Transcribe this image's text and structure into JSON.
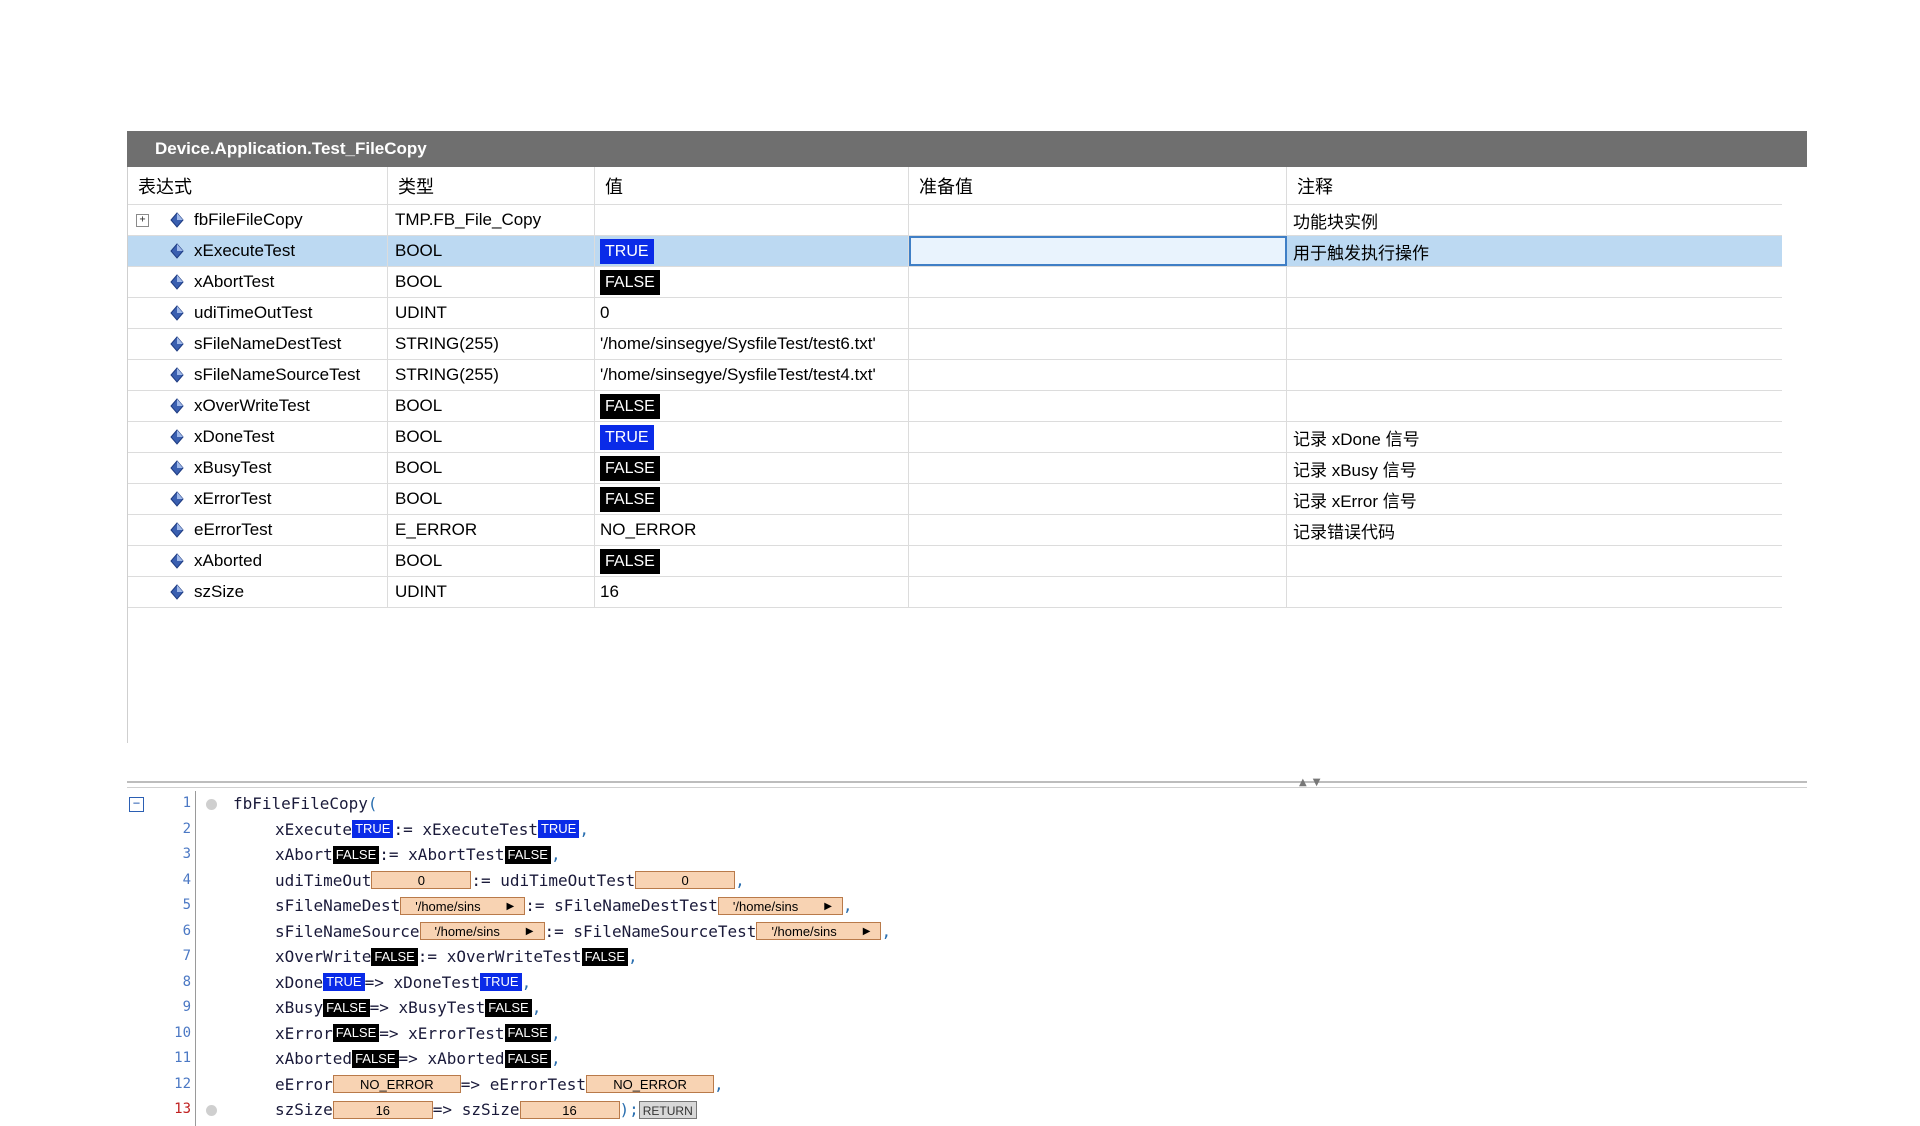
{
  "window": {
    "title": "Device.Application.Test_FileCopy"
  },
  "watch": {
    "headers": {
      "expression": "表达式",
      "type": "类型",
      "value": "值",
      "prepared": "准备值",
      "comment": "注释"
    },
    "rows": [
      {
        "name": "fbFileFileCopy",
        "type": "TMP.FB_File_Copy",
        "value": "",
        "comment": "功能块实例",
        "expand": "+"
      },
      {
        "name": "xExecuteTest",
        "type": "BOOL",
        "value": "TRUE",
        "comment": "用于触发执行操作"
      },
      {
        "name": "xAbortTest",
        "type": "BOOL",
        "value": "FALSE",
        "comment": ""
      },
      {
        "name": "udiTimeOutTest",
        "type": "UDINT",
        "value": "0",
        "comment": ""
      },
      {
        "name": "sFileNameDestTest",
        "type": "STRING(255)",
        "value": "'/home/sinsegye/SysfileTest/test6.txt'",
        "comment": ""
      },
      {
        "name": "sFileNameSourceTest",
        "type": "STRING(255)",
        "value": "'/home/sinsegye/SysfileTest/test4.txt'",
        "comment": ""
      },
      {
        "name": "xOverWriteTest",
        "type": "BOOL",
        "value": "FALSE",
        "comment": ""
      },
      {
        "name": "xDoneTest",
        "type": "BOOL",
        "value": "TRUE",
        "comment": "记录 xDone 信号"
      },
      {
        "name": "xBusyTest",
        "type": "BOOL",
        "value": "FALSE",
        "comment": "记录 xBusy 信号"
      },
      {
        "name": "xErrorTest",
        "type": "BOOL",
        "value": "FALSE",
        "comment": "记录 xError 信号"
      },
      {
        "name": "eErrorTest",
        "type": "E_ERROR",
        "value": "NO_ERROR",
        "comment": "记录错误代码"
      },
      {
        "name": "xAborted",
        "type": "BOOL",
        "value": "FALSE",
        "comment": ""
      },
      {
        "name": "szSize",
        "type": "UDINT",
        "value": "16",
        "comment": ""
      }
    ]
  },
  "editor": {
    "fold": "−",
    "lines": [
      {
        "num": "1",
        "text": "fbFileFileCopy",
        "paren": "("
      },
      {
        "num": "2",
        "param": "xExecute",
        "pval": "TRUE",
        "op": ":=",
        "arg": "xExecuteTest",
        "aval": "TRUE",
        "end": ","
      },
      {
        "num": "3",
        "param": "xAbort",
        "pval": "FALSE",
        "op": ":=",
        "arg": "xAbortTest",
        "aval": "FALSE",
        "end": ","
      },
      {
        "num": "4",
        "param": "udiTimeOut",
        "pval": "0",
        "op": ":=",
        "arg": "udiTimeOutTest",
        "aval": "0",
        "end": ","
      },
      {
        "num": "5",
        "param": "sFileNameDest",
        "pval": "'/home/sins",
        "op": ":=",
        "arg": "sFileNameDestTest",
        "aval": "'/home/sins",
        "end": ","
      },
      {
        "num": "6",
        "param": "sFileNameSource",
        "pval": "'/home/sins",
        "op": ":=",
        "arg": "sFileNameSourceTest",
        "aval": "'/home/sins",
        "end": ","
      },
      {
        "num": "7",
        "param": "xOverWrite",
        "pval": "FALSE",
        "op": ":=",
        "arg": "xOverWriteTest",
        "aval": "FALSE",
        "end": ","
      },
      {
        "num": "8",
        "param": "xDone",
        "pval": "TRUE",
        "op": "=>",
        "arg": "xDoneTest",
        "aval": "TRUE",
        "end": ","
      },
      {
        "num": "9",
        "param": "xBusy",
        "pval": "FALSE",
        "op": "=>",
        "arg": "xBusyTest",
        "aval": "FALSE",
        "end": ","
      },
      {
        "num": "10",
        "param": "xError",
        "pval": "FALSE",
        "op": "=>",
        "arg": "xErrorTest",
        "aval": "FALSE",
        "end": ","
      },
      {
        "num": "11",
        "param": "xAborted",
        "pval": "FALSE",
        "op": "=>",
        "arg": "xAborted",
        "aval": "FALSE",
        "end": ","
      },
      {
        "num": "12",
        "param": "eError",
        "pval": "NO_ERROR",
        "op": "=>",
        "arg": "eErrorTest",
        "aval": "NO_ERROR",
        "end": ","
      },
      {
        "num": "13",
        "param": "szSize",
        "pval": "16",
        "op": "=>",
        "arg": "szSize",
        "aval": "16",
        "end": ");",
        "ret": "RETURN"
      }
    ]
  },
  "colors": {
    "true_badge": "#0a2be8",
    "false_badge": "#000000",
    "value_box": "#f8d3b3",
    "titlebar": "#6f6f6f",
    "selection": "#bcd9f2"
  },
  "icons": {
    "expand": "plus-box-icon",
    "variable": "variable-diamond-icon",
    "fold": "minus-box-icon",
    "breakpoint": "breakpoint-dot-icon"
  }
}
